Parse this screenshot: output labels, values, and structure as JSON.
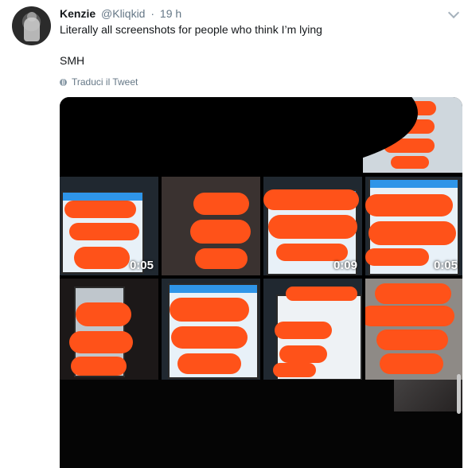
{
  "tweet": {
    "name": "Kenzie",
    "handle": "@Kliqkid",
    "separator": "·",
    "time": "19 h",
    "text_line1": "Literally all screenshots for people who think I’m lying",
    "text_line2": "SMH",
    "translate_label": "Traduci il Tweet"
  },
  "media": {
    "durations": [
      "0:05",
      "0:09",
      "0:05"
    ]
  },
  "colors": {
    "redaction": "#ff5219",
    "link_gray": "#657786",
    "text": "#14171a"
  }
}
